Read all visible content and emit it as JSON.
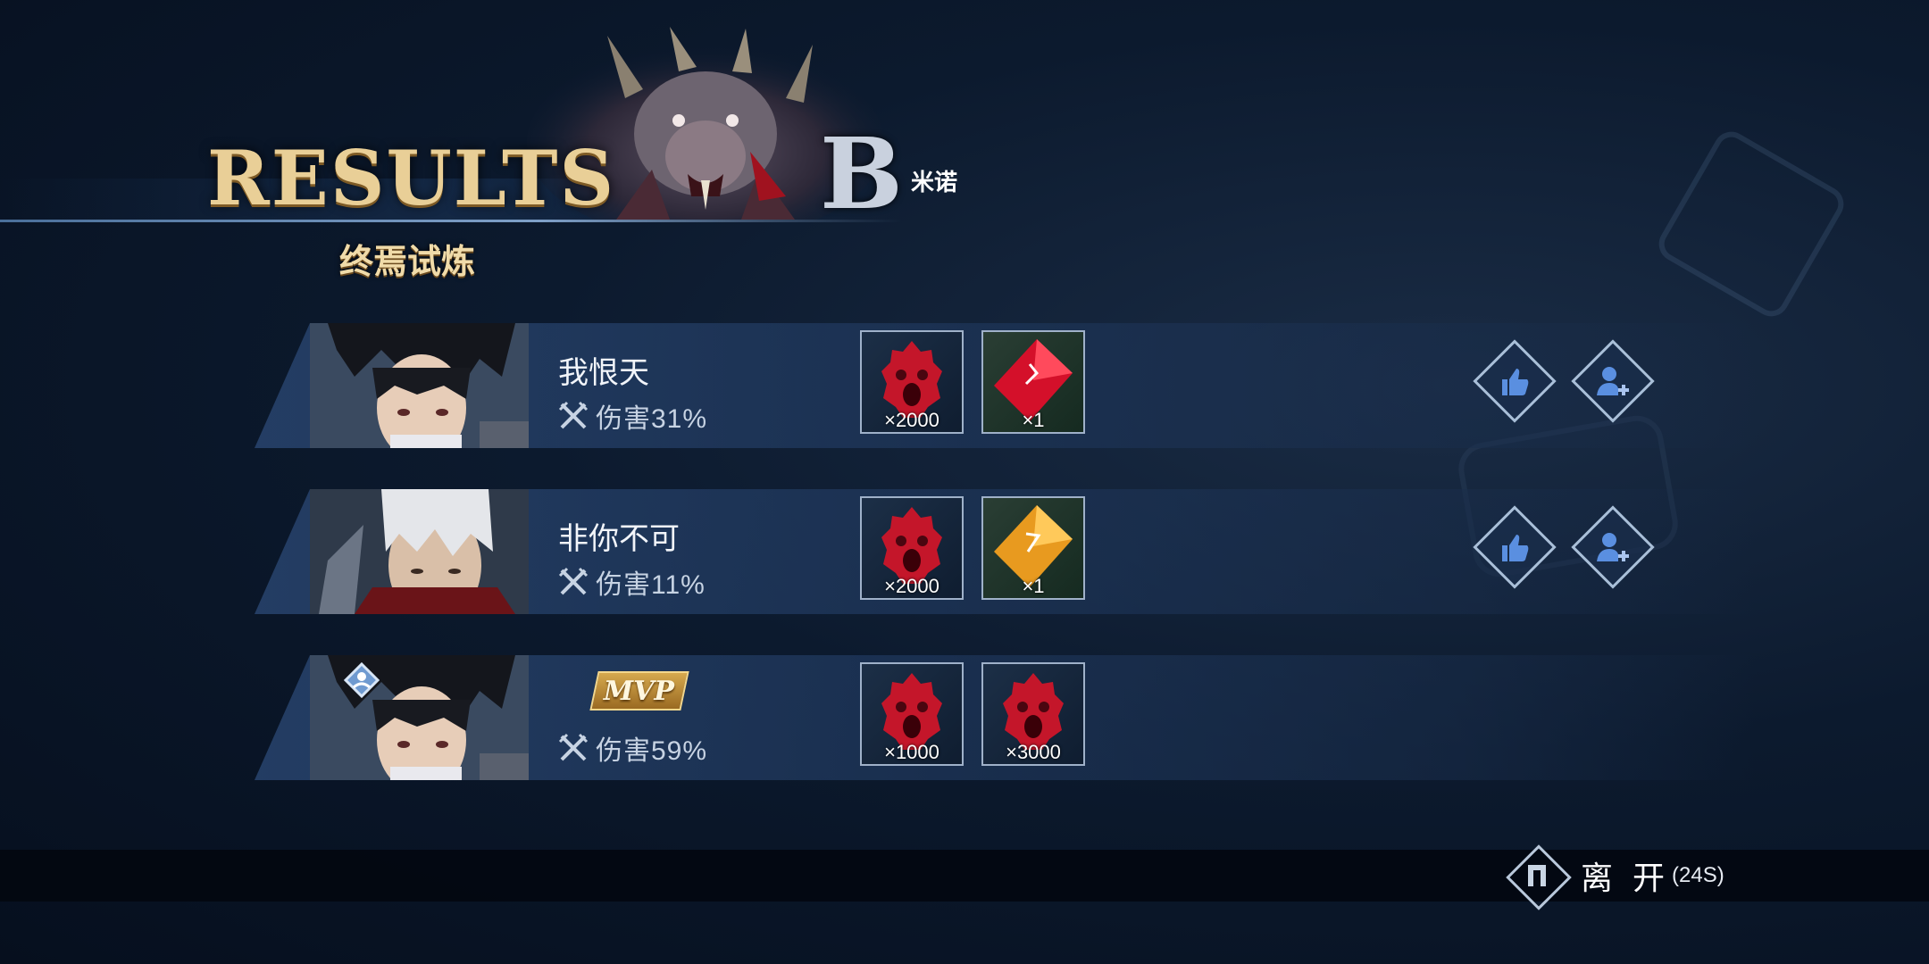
{
  "header": {
    "title": "RESULTS",
    "subtitle": "终焉试炼",
    "boss_grade": "B",
    "boss_name": "米诺"
  },
  "players": [
    {
      "name": "我恨天",
      "damage_label": "伤害31%",
      "is_mvp": false,
      "rewards": [
        {
          "icon": "red-orb-icon",
          "qty": "×2000"
        },
        {
          "icon": "red-gem-icon",
          "qty": "×1"
        }
      ],
      "actions": [
        "like-icon",
        "add-friend-icon"
      ]
    },
    {
      "name": "非你不可",
      "damage_label": "伤害11%",
      "is_mvp": false,
      "rewards": [
        {
          "icon": "red-orb-icon",
          "qty": "×2000"
        },
        {
          "icon": "gold-gem-icon",
          "qty": "×1"
        }
      ],
      "actions": [
        "like-icon",
        "add-friend-icon"
      ]
    },
    {
      "name": "",
      "badge": "MVP",
      "damage_label": "伤害59%",
      "is_mvp": true,
      "rewards": [
        {
          "icon": "red-orb-icon",
          "qty": "×1000"
        },
        {
          "icon": "red-orb-icon",
          "qty": "×3000"
        }
      ],
      "actions": []
    }
  ],
  "footer": {
    "leave_label": "离 开",
    "leave_timer": "(24S)"
  },
  "colors": {
    "title_gold": "#e9cf97",
    "panel_blue": "#28446e",
    "orb_red": "#c4162a",
    "gem_red": "#d4102a",
    "gem_gold": "#e89a1f"
  }
}
